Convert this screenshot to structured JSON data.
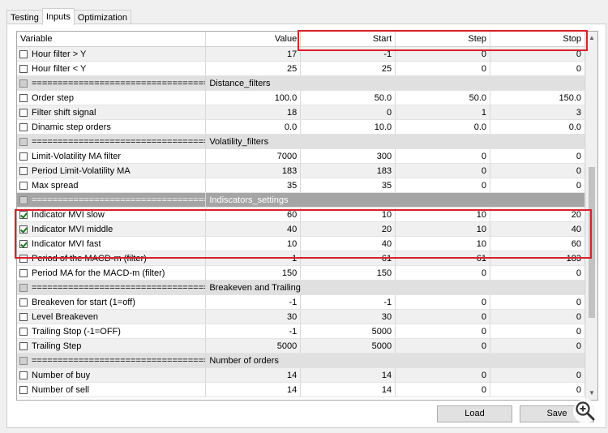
{
  "tabs": [
    "Testing",
    "Inputs",
    "Optimization"
  ],
  "active_tab": "Inputs",
  "columns": [
    "Variable",
    "Value",
    "Start",
    "Step",
    "Stop"
  ],
  "rows": [
    {
      "type": "param",
      "checked": false,
      "name": "Hour filter > Y",
      "value": "17",
      "start": "-1",
      "step": "0",
      "stop": "0"
    },
    {
      "type": "param",
      "checked": false,
      "name": "Hour filter < Y",
      "value": "25",
      "start": "25",
      "step": "0",
      "stop": "0"
    },
    {
      "type": "sep",
      "name": "==================================...",
      "value": "Distance_filters"
    },
    {
      "type": "param",
      "checked": false,
      "name": "Order step",
      "value": "100.0",
      "start": "50.0",
      "step": "50.0",
      "stop": "150.0"
    },
    {
      "type": "param",
      "checked": false,
      "name": "Filter shift signal",
      "value": "18",
      "start": "0",
      "step": "1",
      "stop": "3"
    },
    {
      "type": "param",
      "checked": false,
      "name": "Dinamic step orders",
      "value": "0.0",
      "start": "10.0",
      "step": "0.0",
      "stop": "0.0"
    },
    {
      "type": "sep",
      "name": "==================================...",
      "value": "Volatility_filters"
    },
    {
      "type": "param",
      "checked": false,
      "name": "Limit-Volatility MA filter",
      "value": "7000",
      "start": "300",
      "step": "0",
      "stop": "0"
    },
    {
      "type": "param",
      "checked": false,
      "name": "Period Limit-Volatility MA",
      "value": "183",
      "start": "183",
      "step": "0",
      "stop": "0"
    },
    {
      "type": "param",
      "checked": false,
      "name": "Max spread",
      "value": "35",
      "start": "35",
      "step": "0",
      "stop": "0"
    },
    {
      "type": "sep-dark",
      "name": "==================================...",
      "value": "Indiscators_settings"
    },
    {
      "type": "param",
      "checked": true,
      "name": "Indicator MVI slow",
      "value": "60",
      "start": "10",
      "step": "10",
      "stop": "20"
    },
    {
      "type": "param",
      "checked": true,
      "name": "Indicator MVI middle",
      "value": "40",
      "start": "20",
      "step": "10",
      "stop": "40"
    },
    {
      "type": "param",
      "checked": true,
      "name": "Indicator MVI fast",
      "value": "10",
      "start": "40",
      "step": "10",
      "stop": "60"
    },
    {
      "type": "param",
      "checked": false,
      "name": "Period of the MACD-m (filter)",
      "value": "1",
      "start": "61",
      "step": "61",
      "stop": "183"
    },
    {
      "type": "param",
      "checked": false,
      "name": "Period MA for the MACD-m (filter)",
      "value": "150",
      "start": "150",
      "step": "0",
      "stop": "0"
    },
    {
      "type": "sep",
      "name": "==================================...",
      "value": "Breakeven and Trailing"
    },
    {
      "type": "param",
      "checked": false,
      "name": "Breakeven for start (1=off)",
      "value": "-1",
      "start": "-1",
      "step": "0",
      "stop": "0"
    },
    {
      "type": "param",
      "checked": false,
      "name": "Level Breakeven",
      "value": "30",
      "start": "30",
      "step": "0",
      "stop": "0"
    },
    {
      "type": "param",
      "checked": false,
      "name": "Trailing Stop (-1=OFF)",
      "value": "-1",
      "start": "5000",
      "step": "0",
      "stop": "0"
    },
    {
      "type": "param",
      "checked": false,
      "name": "Trailing Step",
      "value": "5000",
      "start": "5000",
      "step": "0",
      "stop": "0"
    },
    {
      "type": "sep",
      "name": "==================================...",
      "value": "Number of orders"
    },
    {
      "type": "param",
      "checked": false,
      "name": "Number of buy",
      "value": "14",
      "start": "14",
      "step": "0",
      "stop": "0"
    },
    {
      "type": "param",
      "checked": false,
      "name": "Number of sell",
      "value": "14",
      "start": "14",
      "step": "0",
      "stop": "0"
    }
  ],
  "buttons": {
    "load": "Load",
    "save": "Save"
  },
  "highlight_color": "#d9202a",
  "icons": {
    "zoom": "zoom-in-icon",
    "scroll_up": "scroll-up-arrow-icon",
    "scroll_down": "scroll-down-arrow-icon"
  }
}
